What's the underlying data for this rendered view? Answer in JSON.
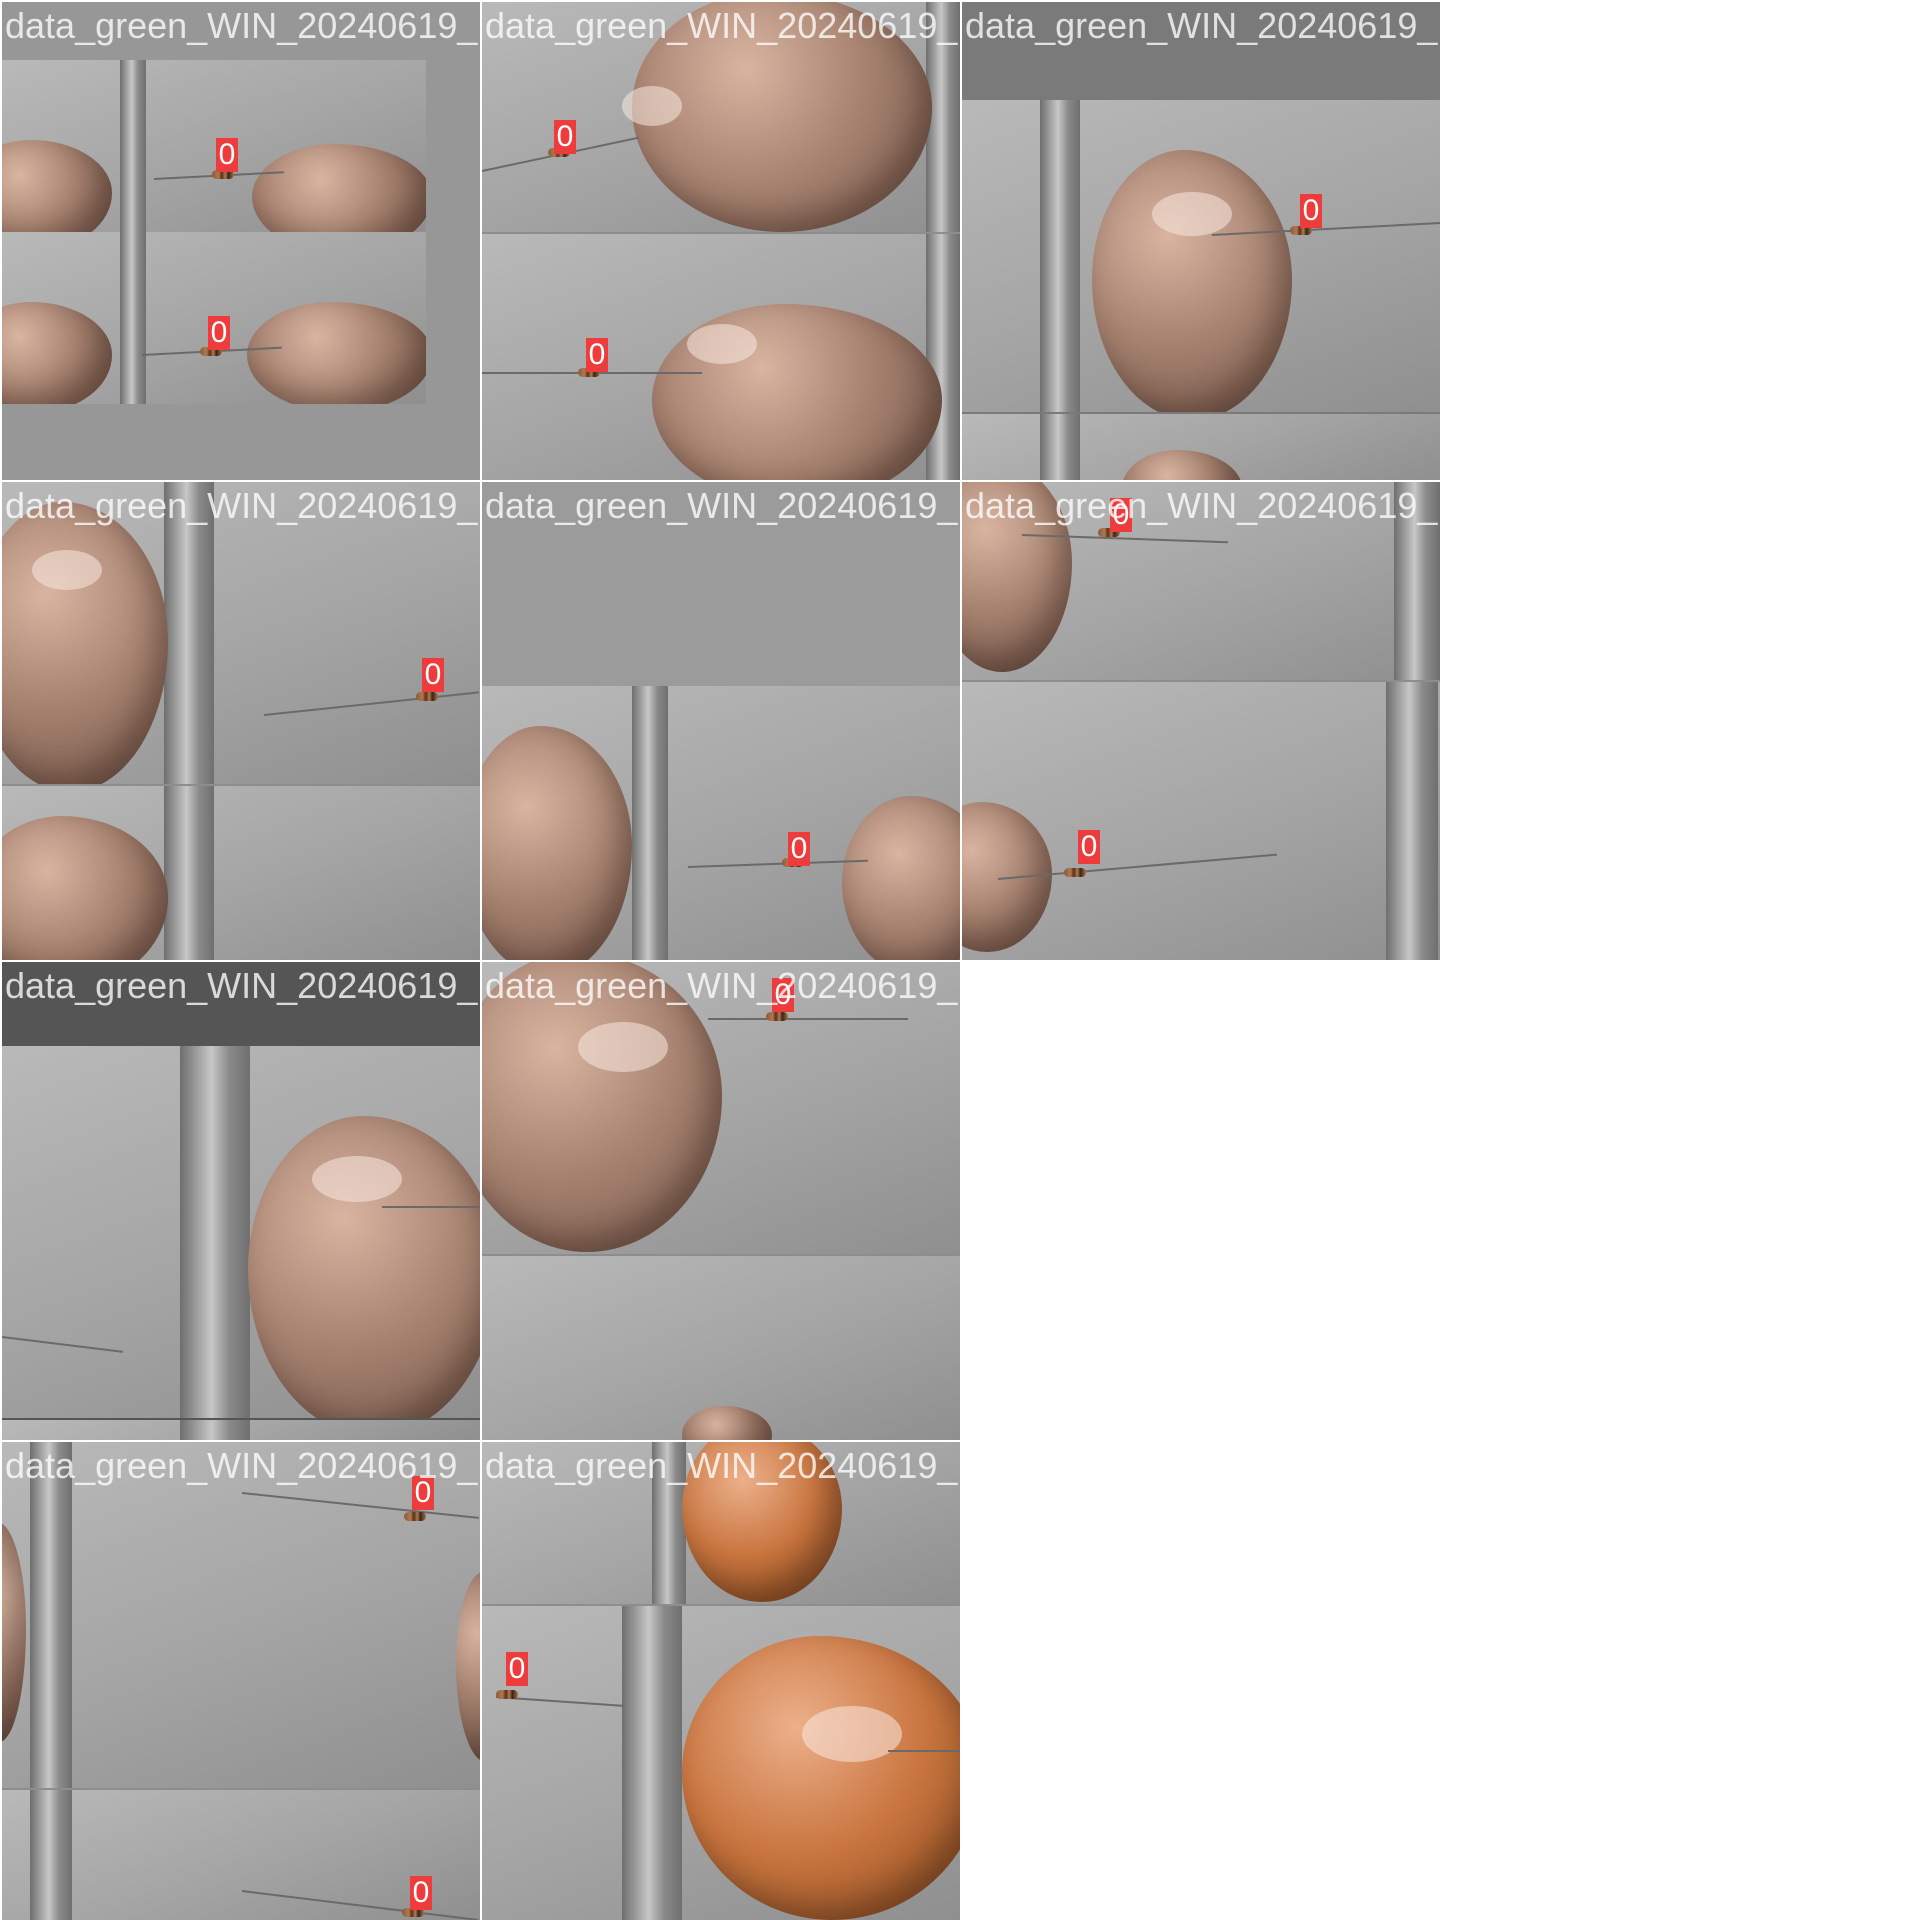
{
  "tiles": [
    {
      "filename": "data_green_WIN_20240619_18_22_12_Pro.jpg",
      "label": "0",
      "label2": "0"
    },
    {
      "filename": "data_green_WIN_20240619_18_20_46_Pro.jpg",
      "label": "0",
      "label2": "0"
    },
    {
      "filename": "data_green_WIN_20240619_18_19_14_Pro.jpg",
      "label": "0"
    },
    {
      "filename": "data_green_WIN_20240619_18_22_31_Pro.jpg",
      "label": "0"
    },
    {
      "filename": "data_green_WIN_20240619_18_21_18_Pro.jpg",
      "label": "0"
    },
    {
      "filename": "data_green_WIN_20240619_18_19_57_Pro.jpg",
      "label": "0",
      "label2": "0"
    },
    {
      "filename": "data_green_WIN_20240619_18_20_31_Pro.jpg"
    },
    {
      "filename": "data_green_WIN_20240619_18_21_55_Pro.jpg",
      "label": "0"
    },
    {
      "filename": "data_green_WIN_20240619_18_19_01_Pro.jpg",
      "label": "0",
      "label2": "0"
    },
    {
      "filename": "data_green_WIN_20240619_18_19_05_Pro.jpg",
      "label": "0"
    }
  ]
}
